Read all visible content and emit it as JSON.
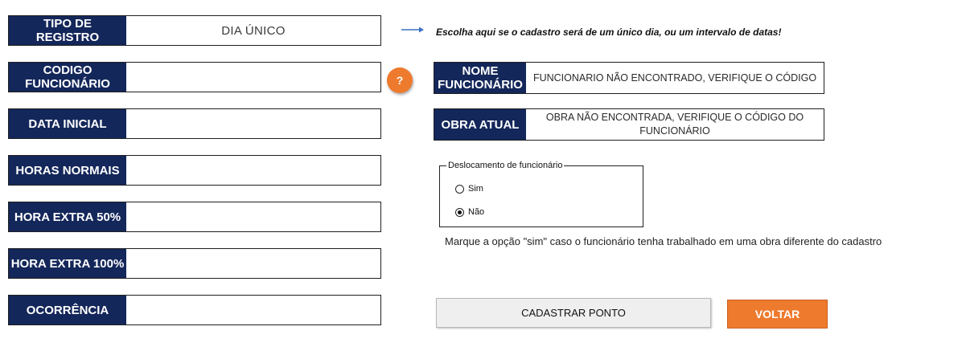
{
  "form": {
    "tipo_registro": {
      "label": "TIPO DE REGISTRO",
      "value": "DIA ÚNICO"
    },
    "codigo_funcionario": {
      "label": "CODIGO\nFUNCIONÁRIO",
      "value": ""
    },
    "data_inicial": {
      "label": "DATA INICIAL",
      "value": ""
    },
    "horas_normais": {
      "label": "HORAS NORMAIS",
      "value": ""
    },
    "hora_extra_50": {
      "label": "HORA EXTRA 50%",
      "value": ""
    },
    "hora_extra_100": {
      "label": "HORA EXTRA 100%",
      "value": ""
    },
    "ocorrencia": {
      "label": "OCORRÊNCIA",
      "value": ""
    }
  },
  "help_button": {
    "label": "?",
    "color": "#ee7a2e"
  },
  "hint": {
    "text": "Escolha aqui se o cadastro será de um único dia, ou um intervalo de datas!",
    "arrow_color": "#3c6fc4"
  },
  "info": {
    "nome_funcionario": {
      "label": "NOME\nFUNCIONÁRIO",
      "value": "FUNCIONARIO NÃO ENCONTRADO, VERIFIQUE O CÓDIGO"
    },
    "obra_atual": {
      "label": "OBRA ATUAL",
      "value": "OBRA NÃO ENCONTRADA, VERIFIQUE O CÓDIGO DO FUNCIONÁRIO"
    }
  },
  "deslocamento": {
    "legend": "Deslocamento de funcionário",
    "options": [
      {
        "label": "Sim",
        "checked": false
      },
      {
        "label": "Não",
        "checked": true
      }
    ],
    "note": "Marque a opção \"sim\" caso o funcionário tenha trabalhado em uma obra diferente do cadastro"
  },
  "buttons": {
    "cadastrar": "CADASTRAR PONTO",
    "voltar": "VOLTAR"
  },
  "colors": {
    "label_bg": "#14275a",
    "accent": "#ee7a2e"
  }
}
